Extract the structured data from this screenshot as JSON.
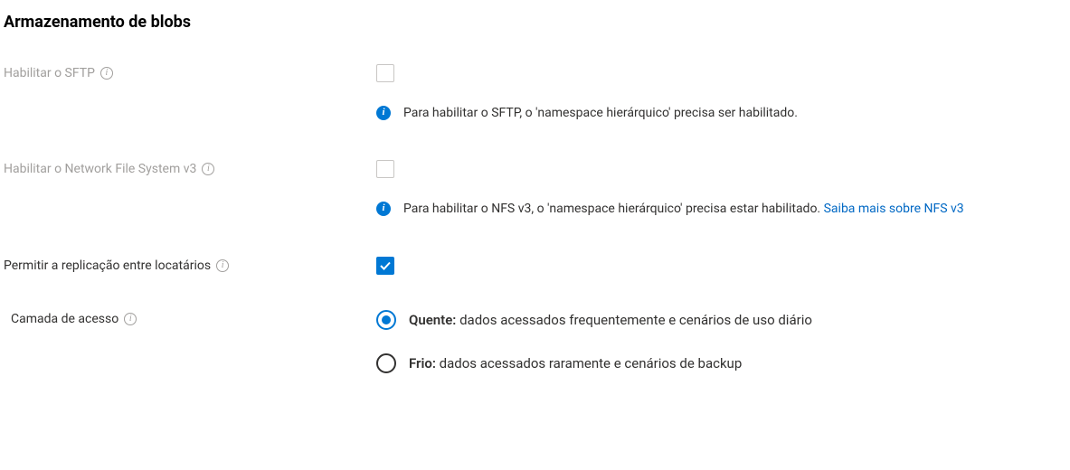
{
  "section_title": "Armazenamento de blobs",
  "fields": {
    "sftp": {
      "label": "Habilitar o SFTP",
      "checked": false,
      "disabled": true,
      "hint": "Para habilitar o SFTP, o 'namespace hierárquico' precisa ser habilitado."
    },
    "nfs": {
      "label": "Habilitar o Network File System v3",
      "checked": false,
      "disabled": true,
      "hint_text": "Para habilitar o NFS v3, o 'namespace hierárquico' precisa estar habilitado. ",
      "hint_link": "Saiba mais sobre NFS v3"
    },
    "cross_tenant": {
      "label": "Permitir a replicação entre locatários",
      "checked": true,
      "disabled": false
    },
    "tier": {
      "label": "Camada de acesso",
      "options": {
        "hot": {
          "title": "Quente:",
          "desc": " dados acessados frequentemente e cenários de uso diário",
          "selected": true
        },
        "cool": {
          "title": "Frio:",
          "desc": " dados acessados raramente e cenários de backup",
          "selected": false
        }
      }
    }
  }
}
